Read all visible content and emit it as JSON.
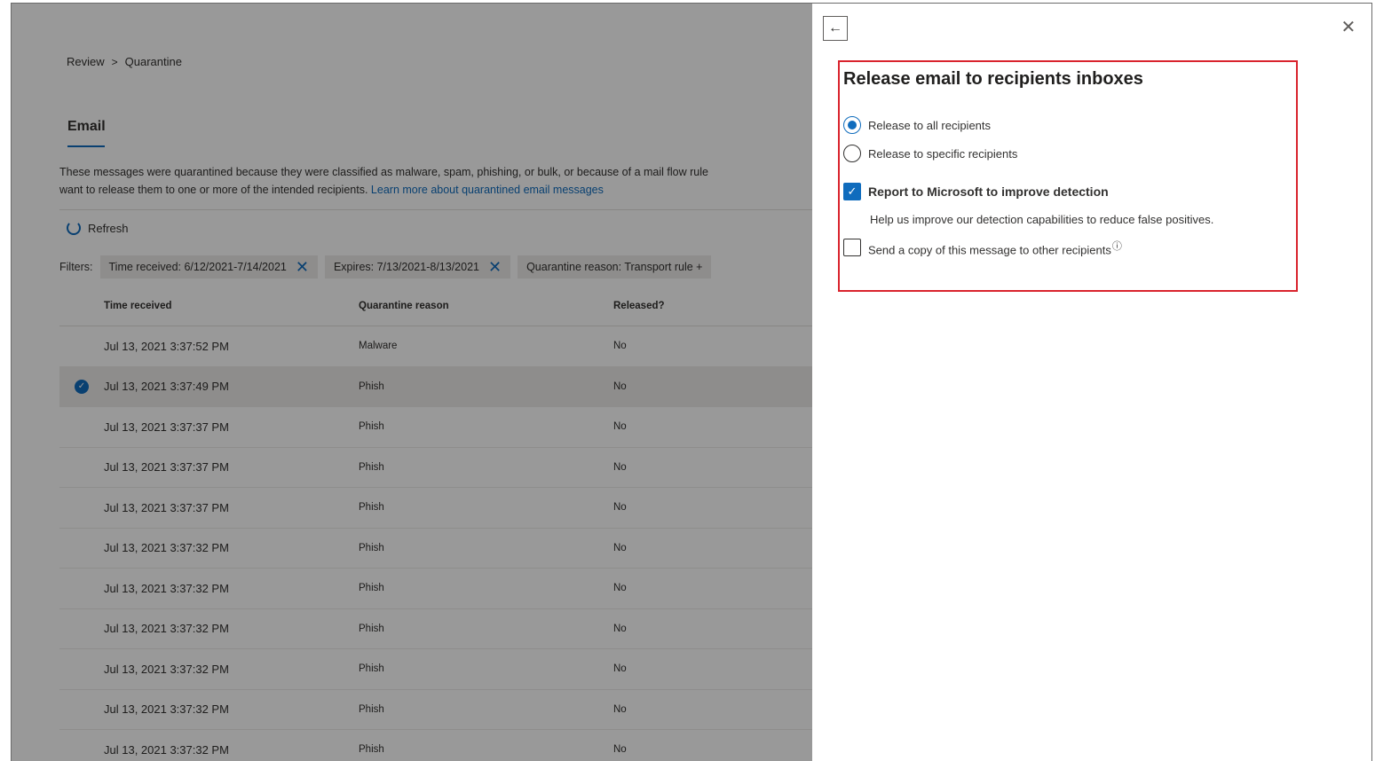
{
  "breadcrumb": {
    "parent": "Review",
    "separator": ">",
    "current": "Quarantine"
  },
  "tab": {
    "label": "Email"
  },
  "description": {
    "line1": "These messages were quarantined because they were classified as malware, spam, phishing, or bulk, or because of a mail flow rule",
    "line2_text": "want to release them to one or more of the intended recipients.",
    "line2_link": "Learn more about quarantined email messages"
  },
  "toolbar": {
    "refresh_label": "Refresh"
  },
  "filters": {
    "label": "Filters:",
    "chips": [
      "Time received: 6/12/2021-7/14/2021",
      "Expires: 7/13/2021-8/13/2021",
      "Quarantine reason: Transport rule +"
    ]
  },
  "table": {
    "headers": {
      "time": "Time received",
      "reason": "Quarantine reason",
      "released": "Released?"
    },
    "rows": [
      {
        "time": "Jul 13, 2021 3:37:52 PM",
        "reason": "Malware",
        "released": "No",
        "selected": false
      },
      {
        "time": "Jul 13, 2021 3:37:49 PM",
        "reason": "Phish",
        "released": "No",
        "selected": true
      },
      {
        "time": "Jul 13, 2021 3:37:37 PM",
        "reason": "Phish",
        "released": "No",
        "selected": false
      },
      {
        "time": "Jul 13, 2021 3:37:37 PM",
        "reason": "Phish",
        "released": "No",
        "selected": false
      },
      {
        "time": "Jul 13, 2021 3:37:37 PM",
        "reason": "Phish",
        "released": "No",
        "selected": false
      },
      {
        "time": "Jul 13, 2021 3:37:32 PM",
        "reason": "Phish",
        "released": "No",
        "selected": false
      },
      {
        "time": "Jul 13, 2021 3:37:32 PM",
        "reason": "Phish",
        "released": "No",
        "selected": false
      },
      {
        "time": "Jul 13, 2021 3:37:32 PM",
        "reason": "Phish",
        "released": "No",
        "selected": false
      },
      {
        "time": "Jul 13, 2021 3:37:32 PM",
        "reason": "Phish",
        "released": "No",
        "selected": false
      },
      {
        "time": "Jul 13, 2021 3:37:32 PM",
        "reason": "Phish",
        "released": "No",
        "selected": false
      },
      {
        "time": "Jul 13, 2021 3:37:32 PM",
        "reason": "Phish",
        "released": "No",
        "selected": false
      }
    ]
  },
  "panel": {
    "back_icon": "back-arrow-icon",
    "close_icon": "close-icon",
    "title": "Release email to recipients inboxes",
    "options": {
      "release_all": {
        "label": "Release to all recipients",
        "checked": true
      },
      "release_specific": {
        "label": "Release to specific recipients",
        "checked": false
      },
      "report": {
        "label": "Report to Microsoft to improve detection",
        "checked": true
      },
      "report_help": "Help us improve our detection capabilities to reduce false positives.",
      "send_copy": {
        "label": "Send a copy of this message to other recipients",
        "checked": false
      }
    }
  },
  "colors": {
    "accent": "#0f6cbd",
    "highlight_border": "#d9232d"
  }
}
